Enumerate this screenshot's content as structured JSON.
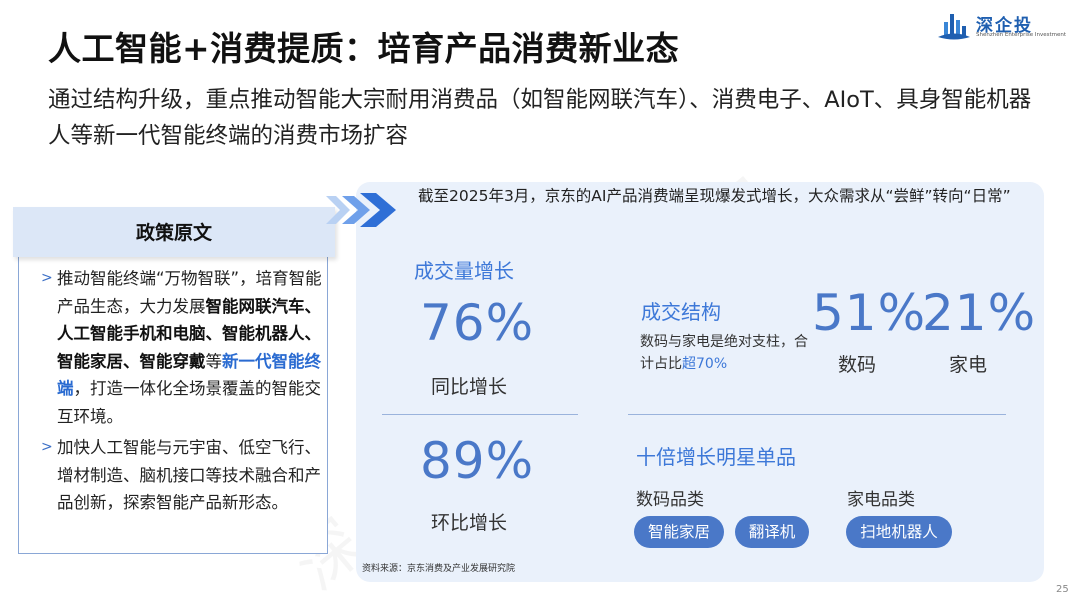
{
  "header": {
    "title": "人工智能+消费提质：培育产品消费新业态",
    "subtitle": "通过结构升级，重点推动智能大宗耐用消费品（如智能网联汽车）、消费电子、AIoT、具身智能机器人等新一代智能终端的消费市场扩容"
  },
  "logo": {
    "name": "深企投",
    "english": "Shenzhen Enterprise Investment"
  },
  "watermark": "深企投产业研究院",
  "policy": {
    "heading": "政策原文",
    "items": [
      {
        "marker": ">",
        "parts": [
          {
            "text": "推动智能终端“万物智联”，培育智能产品生态，大力发展",
            "style": "normal"
          },
          {
            "text": "智能网联汽车、人工智能手机和电脑、智能机器人、智能家居、智能穿戴",
            "style": "bold"
          },
          {
            "text": "等",
            "style": "normal"
          },
          {
            "text": "新一代智能终端",
            "style": "highlight"
          },
          {
            "text": "，打造一体化全场景覆盖的智能交互环境。",
            "style": "normal"
          }
        ]
      },
      {
        "marker": ">",
        "parts": [
          {
            "text": "加快人工智能与元宇宙、低空飞行、增材制造、脑机接口等技术融合和产品创新，探索智能产品新形态。",
            "style": "normal"
          }
        ]
      }
    ]
  },
  "panel": {
    "intro": "截至2025年3月，京东的AI产品消费端呈现爆发式增长，大众需求从“尝鲜”转向“日常”",
    "volume": {
      "title": "成交量增长",
      "yoy_value": "76%",
      "yoy_label": "同比增长",
      "mom_value": "89%",
      "mom_label": "环比增长"
    },
    "structure": {
      "title": "成交结构",
      "note_prefix": "数码与家电是绝对支柱，合计占比",
      "note_highlight": "超70%",
      "digital_value": "51%",
      "digital_label": "数码",
      "appliance_value": "21%",
      "appliance_label": "家电"
    },
    "stars": {
      "title": "十倍增长明星单品",
      "digital_category": "数码品类",
      "appliance_category": "家电品类",
      "digital_items": [
        "智能家居",
        "翻译机"
      ],
      "appliance_items": [
        "扫地机器人"
      ]
    },
    "source": "资料来源：京东消费及产业发展研究院"
  },
  "page_number": "25",
  "colors": {
    "accent": "#3d78d8",
    "number": "#4a78c8",
    "panel_bg": "#eaf1fb",
    "policy_head_bg": "#dce7f7"
  }
}
